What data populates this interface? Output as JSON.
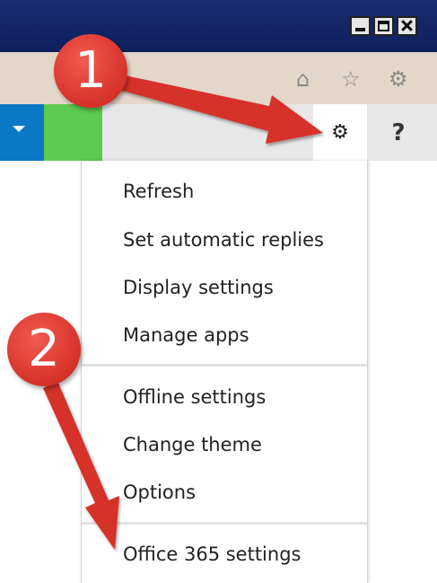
{
  "window": {
    "minimize_glyph": "",
    "maximize_glyph": "",
    "close_glyph": ""
  },
  "browser_bar": {
    "icons": [
      "home-icon",
      "star-icon",
      "gear-icon"
    ],
    "home_glyph": "⌂",
    "star_glyph": "☆",
    "gear_glyph": "⚙"
  },
  "suite_bar": {
    "settings_glyph": "⚙",
    "help_label": "?",
    "chevron_glyph": "▾"
  },
  "menu": {
    "items": [
      "Refresh",
      "Set automatic replies",
      "Display settings",
      "Manage apps",
      "Offline settings",
      "Change theme",
      "Options",
      "Office 365 settings"
    ]
  },
  "callouts": {
    "one": "1",
    "two": "2"
  },
  "colors": {
    "titlebar": "#0e1f5c",
    "browserbar": "#e3d7c9",
    "suite_blue": "#0b78c8",
    "suite_green": "#5dcb50",
    "callout_red": "#d6322a"
  }
}
